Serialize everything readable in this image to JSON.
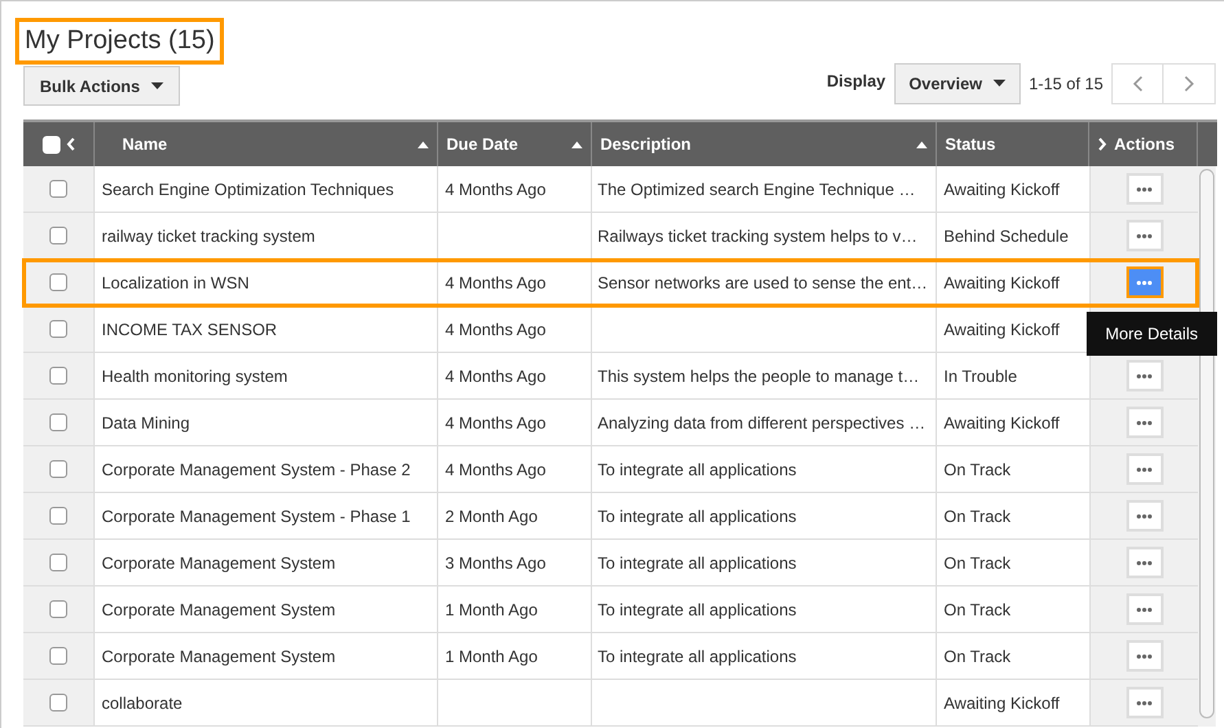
{
  "title": {
    "text": "My Projects (15)",
    "highlighted": true
  },
  "bulk_actions": {
    "label": "Bulk Actions"
  },
  "display": {
    "label": "Display",
    "value": "Overview"
  },
  "pagination": {
    "range": "1-15 of 15"
  },
  "table": {
    "select_all": {
      "checked": false
    },
    "columns": [
      {
        "label": "Name",
        "sortable": true
      },
      {
        "label": "Due Date",
        "sortable": true
      },
      {
        "label": "Description",
        "sortable": true
      },
      {
        "label": "Status",
        "sortable": false
      },
      {
        "label": "Actions",
        "sortable": false
      }
    ],
    "rows": [
      {
        "checked": false,
        "name": "Search Engine Optimization Techniques",
        "due": "4 Months Ago",
        "description": "The Optimized search Engine Technique …",
        "status": "Awaiting Kickoff",
        "highlighted": false,
        "action_active": false
      },
      {
        "checked": false,
        "name": "railway ticket tracking system",
        "due": "",
        "description": "Railways ticket  tracking system helps to v…",
        "status": "Behind Schedule",
        "highlighted": false,
        "action_active": false
      },
      {
        "checked": false,
        "name": "Localization in WSN",
        "due": "4 Months Ago",
        "description": "Sensor networks are used to sense the ent…",
        "status": "Awaiting Kickoff",
        "highlighted": true,
        "action_active": true
      },
      {
        "checked": false,
        "name": "INCOME TAX SENSOR",
        "due": "4 Months Ago",
        "description": "",
        "status": "Awaiting Kickoff",
        "highlighted": false,
        "action_active": false
      },
      {
        "checked": false,
        "name": "Health monitoring system",
        "due": "4 Months Ago",
        "description": "This system helps the people to manage t…",
        "status": "In Trouble",
        "highlighted": false,
        "action_active": false
      },
      {
        "checked": false,
        "name": "Data Mining",
        "due": "4 Months Ago",
        "description": "Analyzing data from different perspectives …",
        "status": "Awaiting Kickoff",
        "highlighted": false,
        "action_active": false
      },
      {
        "checked": false,
        "name": "Corporate Management System - Phase 2",
        "due": "4 Months Ago",
        "description": "To integrate all applications",
        "status": "On Track",
        "highlighted": false,
        "action_active": false
      },
      {
        "checked": false,
        "name": "Corporate Management System - Phase 1",
        "due": "2 Month Ago",
        "description": "To integrate all applications",
        "status": "On Track",
        "highlighted": false,
        "action_active": false
      },
      {
        "checked": false,
        "name": "Corporate Management System",
        "due": "3 Months Ago",
        "description": "To integrate all applications",
        "status": "On Track",
        "highlighted": false,
        "action_active": false
      },
      {
        "checked": false,
        "name": "Corporate Management System",
        "due": "1 Month Ago",
        "description": "To integrate all applications",
        "status": "On Track",
        "highlighted": false,
        "action_active": false
      },
      {
        "checked": false,
        "name": "Corporate Management System",
        "due": "1 Month Ago",
        "description": "To integrate all applications",
        "status": "On Track",
        "highlighted": false,
        "action_active": false
      },
      {
        "checked": false,
        "name": "collaborate",
        "due": "",
        "description": "",
        "status": "Awaiting Kickoff",
        "highlighted": false,
        "action_active": false
      }
    ]
  },
  "tooltip": {
    "text": "More Details"
  }
}
